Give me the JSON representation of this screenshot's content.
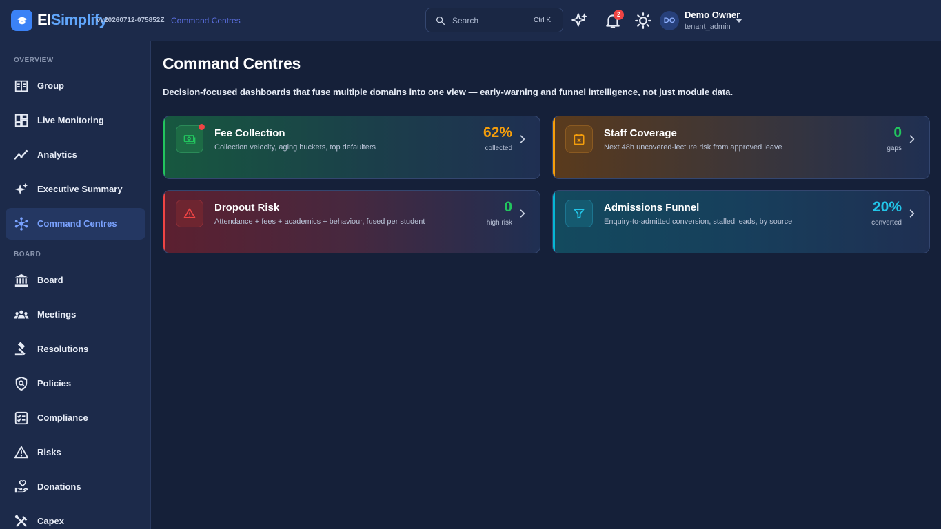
{
  "header": {
    "brand_part1": "El",
    "brand_part2": "Simplify",
    "version": "vv20260712-075852Z",
    "breadcrumb": "Command Centres",
    "search_label": "Search",
    "search_shortcut": "Ctrl K",
    "notification_count": "2",
    "user_initials": "DO",
    "user_name": "Demo Owner",
    "user_role": "tenant_admin"
  },
  "sidebar": {
    "sections": [
      {
        "label": "OVERVIEW",
        "items": [
          {
            "label": "Group",
            "icon": "group-icon"
          },
          {
            "label": "Live Monitoring",
            "icon": "dashboard-icon"
          },
          {
            "label": "Analytics",
            "icon": "analytics-icon"
          },
          {
            "label": "Executive Summary",
            "icon": "sparkle-icon"
          },
          {
            "label": "Command Centres",
            "icon": "hub-icon",
            "active": true
          }
        ]
      },
      {
        "label": "BOARD",
        "items": [
          {
            "label": "Board",
            "icon": "institution-icon"
          },
          {
            "label": "Meetings",
            "icon": "people-icon"
          },
          {
            "label": "Resolutions",
            "icon": "gavel-icon"
          },
          {
            "label": "Policies",
            "icon": "policy-icon"
          },
          {
            "label": "Compliance",
            "icon": "checklist-icon"
          },
          {
            "label": "Risks",
            "icon": "warning-icon"
          },
          {
            "label": "Donations",
            "icon": "donation-icon"
          },
          {
            "label": "Capex",
            "icon": "tools-icon"
          }
        ]
      }
    ]
  },
  "main": {
    "title": "Command Centres",
    "description": "Decision-focused dashboards that fuse multiple domains into one view — early-warning and funnel intelligence, not just module data.",
    "cards": [
      {
        "title": "Fee Collection",
        "subtitle": "Collection velocity, aging buckets, top defaulters",
        "value": "62%",
        "unit": "collected",
        "icon": "cash-icon",
        "accent": "#22c55e",
        "value_color": "#f59e0b"
      },
      {
        "title": "Staff Coverage",
        "subtitle": "Next 48h uncovered-lecture risk from approved leave",
        "value": "0",
        "unit": "gaps",
        "icon": "calendar-x-icon",
        "accent": "#f59e0b",
        "value_color": "#22c55e"
      },
      {
        "title": "Dropout Risk",
        "subtitle": "Attendance + fees + academics + behaviour, fused per student",
        "value": "0",
        "unit": "high risk",
        "icon": "warning-icon",
        "accent": "#ef4444",
        "value_color": "#22c55e"
      },
      {
        "title": "Admissions Funnel",
        "subtitle": "Enquiry-to-admitted conversion, stalled leads, by source",
        "value": "20%",
        "unit": "converted",
        "icon": "funnel-icon",
        "accent": "#06b6d4",
        "value_color": "#22c5e8"
      }
    ]
  }
}
